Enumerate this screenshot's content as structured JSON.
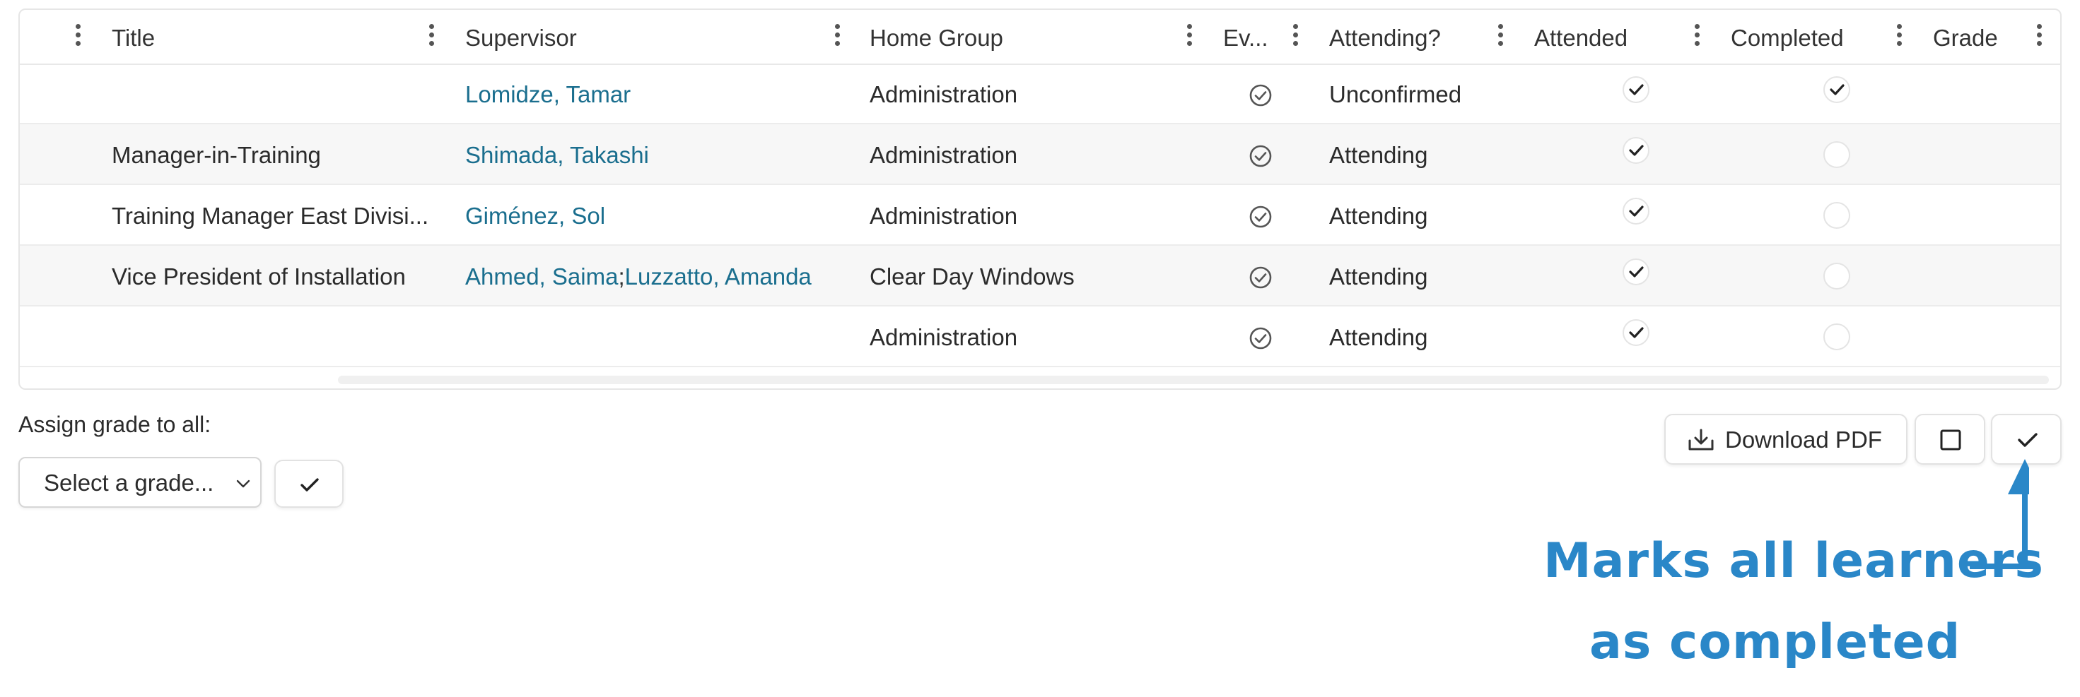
{
  "table": {
    "columns": [
      {
        "label": ""
      },
      {
        "label": "Title"
      },
      {
        "label": "Supervisor"
      },
      {
        "label": "Home Group"
      },
      {
        "label": "Ev..."
      },
      {
        "label": "Attending?"
      },
      {
        "label": "Attended"
      },
      {
        "label": "Completed"
      },
      {
        "label": "Grade"
      }
    ],
    "rows": [
      {
        "title": "",
        "supervisor_1": "Lomidze, Tamar",
        "separator": "",
        "supervisor_2": "",
        "home_group": "Administration",
        "attending": "Unconfirmed",
        "attended": true,
        "completed": true
      },
      {
        "title": "Manager-in-Training",
        "supervisor_1": "Shimada, Takashi",
        "separator": "",
        "supervisor_2": "",
        "home_group": "Administration",
        "attending": "Attending",
        "attended": true,
        "completed": false
      },
      {
        "title": "Training Manager East Divisi...",
        "supervisor_1": "Giménez, Sol",
        "separator": "",
        "supervisor_2": "",
        "home_group": "Administration",
        "attending": "Attending",
        "attended": true,
        "completed": false
      },
      {
        "title": "Vice President of Installation",
        "supervisor_1": "Ahmed, Saima",
        "separator": ";",
        "supervisor_2": "Luzzatto, Amanda",
        "home_group": "Clear Day Windows",
        "attending": "Attending",
        "attended": true,
        "completed": false
      },
      {
        "title": "",
        "supervisor_1": "",
        "separator": "",
        "supervisor_2": "",
        "home_group": "Administration",
        "attending": "Attending",
        "attended": true,
        "completed": false
      }
    ]
  },
  "assign": {
    "label": "Assign grade to all:",
    "select_value": "Select a grade..."
  },
  "actions": {
    "download_pdf": "Download PDF"
  },
  "callout": {
    "line1": "Marks all learners",
    "line2": "as completed"
  },
  "colors": {
    "link": "#1a6e8e",
    "callout": "#2a87c8"
  }
}
